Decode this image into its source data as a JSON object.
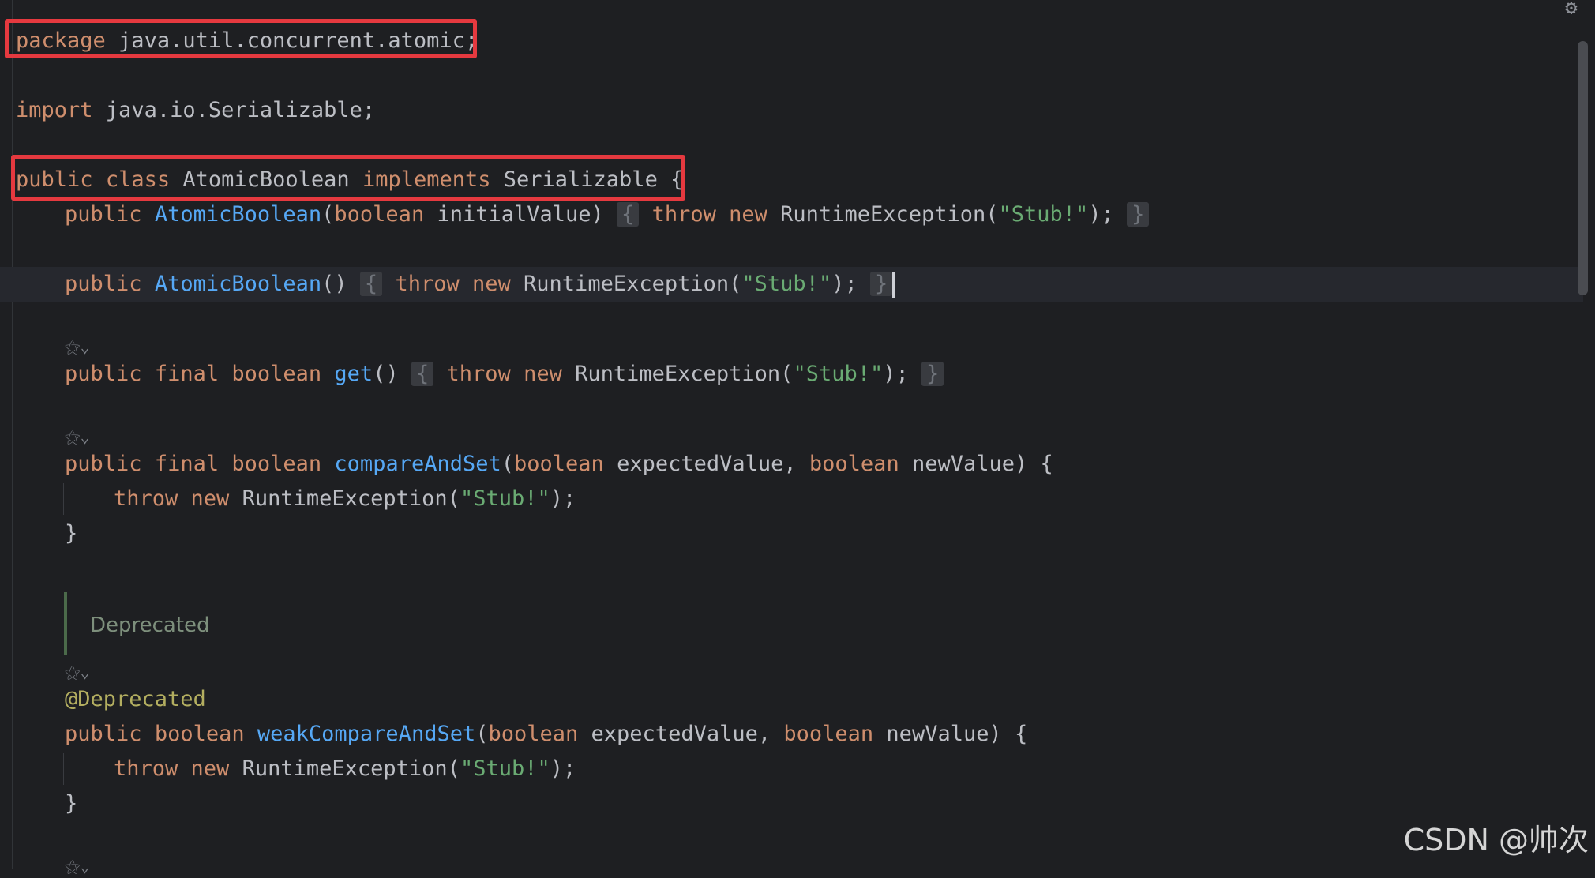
{
  "editor": {
    "settings_icon": "gear-icon",
    "inlay_icon": "ai-inlay-icon",
    "lines": {
      "package": {
        "kw": "package",
        "rest": " java.util.concurrent.atomic;"
      },
      "import": {
        "kw": "import",
        "rest": " java.io.Serializable;"
      },
      "class_decl": {
        "kw1": "public",
        "kw2": "class",
        "name": " AtomicBoolean ",
        "kw3": "implements",
        "rest": " Serializable {"
      },
      "ctor1": {
        "kw": "public",
        "fn": "AtomicBoolean",
        "p1": "(",
        "kw_bool": "boolean",
        "p2": " initialValue)",
        "open": "{",
        "throw": "throw",
        "new": "new",
        "ex": " RuntimeException(",
        "str": "\"Stub!\"",
        "end": ");",
        "close": "}"
      },
      "ctor2": {
        "kw": "public",
        "fn": "AtomicBoolean",
        "p": "()",
        "open": "{",
        "throw": "throw",
        "new": "new",
        "ex": " RuntimeException(",
        "str": "\"Stub!\"",
        "end": ");",
        "close": "}"
      },
      "get": {
        "kw1": "public",
        "kw2": "final",
        "kw3": "boolean",
        "fn": "get",
        "p": "()",
        "open": "{",
        "throw": "throw",
        "new": "new",
        "ex": " RuntimeException(",
        "str": "\"Stub!\"",
        "end": ");",
        "close": "}"
      },
      "cas": {
        "kw1": "public",
        "kw2": "final",
        "kw3": "boolean",
        "fn": "compareAndSet",
        "p1": "(",
        "kw4": "boolean",
        "p2": " expectedValue, ",
        "kw5": "boolean",
        "p3": " newValue) {"
      },
      "cas_body": {
        "throw": "throw",
        "new": "new",
        "ex": " RuntimeException(",
        "str": "\"Stub!\"",
        "end": ");"
      },
      "cas_close": "}",
      "doc": "Deprecated",
      "annotation": "@Deprecated",
      "weak": {
        "kw1": "public",
        "kw2": "boolean",
        "fn": "weakCompareAndSet",
        "p1": "(",
        "kw3": "boolean",
        "p2": " expectedValue, ",
        "kw4": "boolean",
        "p3": " newValue) {"
      },
      "weak_body": {
        "throw": "throw",
        "new": "new",
        "ex": " RuntimeException(",
        "str": "\"Stub!\"",
        "end": ");"
      },
      "weak_close": "}"
    },
    "inlay_glyph": "⚝⌄"
  },
  "watermark": "CSDN @帅次",
  "colors": {
    "background": "#1e1f22",
    "keyword": "#cf8e6d",
    "function": "#56a8f5",
    "string": "#6aab73",
    "annotation": "#b3ae60",
    "highlight_box": "#e5393f"
  }
}
